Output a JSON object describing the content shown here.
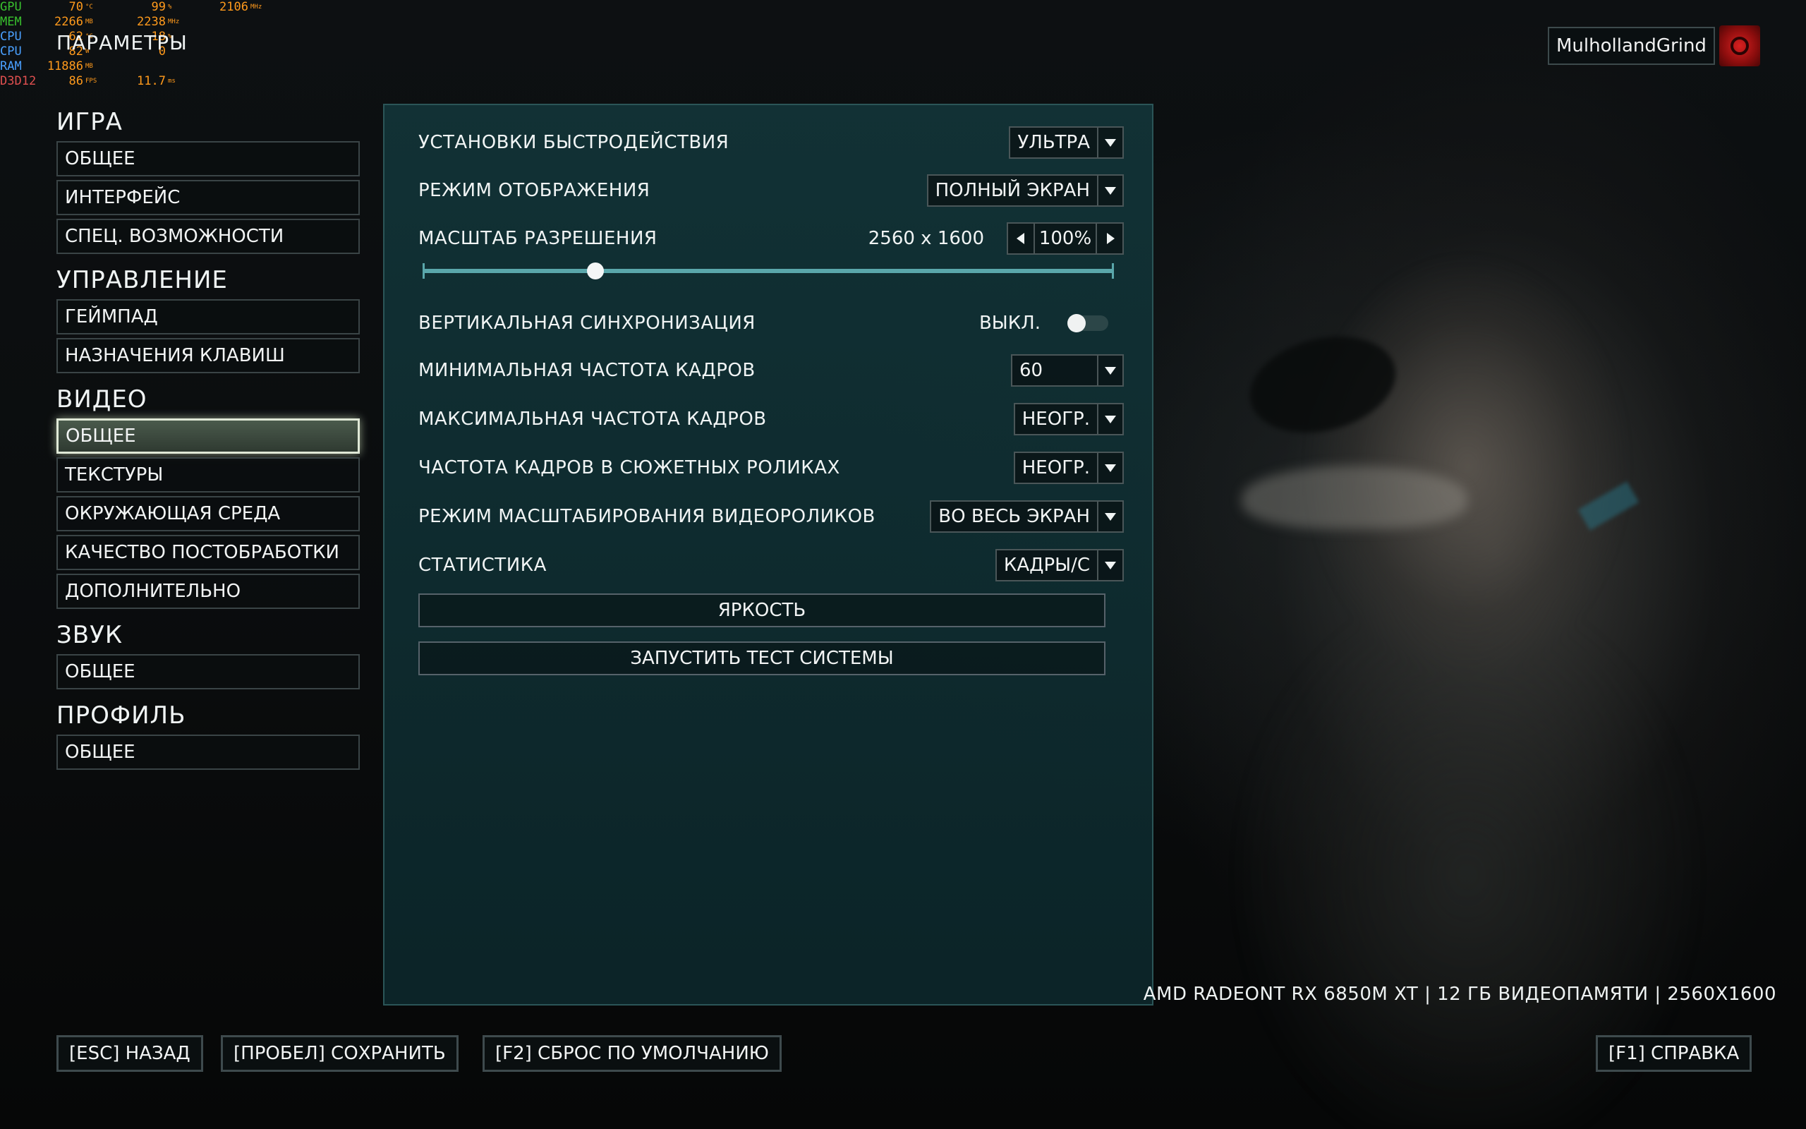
{
  "overlay": {
    "rows": [
      {
        "label": "GPU",
        "label_color": "green",
        "v1": "70",
        "u1": "°C",
        "v2": "99",
        "u2": "%",
        "v3": "2106",
        "u3": "MHz"
      },
      {
        "label": "MEM",
        "label_color": "green",
        "v1": "2266",
        "u1": "MB",
        "v2": "2238",
        "u2": "MHz",
        "v3": "",
        "u3": ""
      },
      {
        "label": "CPU",
        "label_color": "blue",
        "v1": "62",
        "u1": "°C",
        "v2": "18",
        "u2": "%",
        "v3": "",
        "u3": ""
      },
      {
        "label": "CPU",
        "label_color": "blue",
        "v1": "82",
        "u1": "W",
        "v2": "0",
        "u2": "",
        "v3": "",
        "u3": ""
      },
      {
        "label": "RAM",
        "label_color": "blue",
        "v1": "11886",
        "u1": "MB",
        "v2": "",
        "u2": "",
        "v3": "",
        "u3": ""
      },
      {
        "label": "D3D12",
        "label_color": "red",
        "v1": "86",
        "u1": "FPS",
        "v2": "11.7",
        "u2": "ms",
        "v3": "",
        "u3": ""
      }
    ]
  },
  "header": {
    "title": "ПАРАМЕТРЫ",
    "username": "MulhollandGrind"
  },
  "sidebar": {
    "sections": [
      {
        "title": "ИГРА",
        "items": [
          {
            "label": "ОБЩЕЕ",
            "selected": false
          },
          {
            "label": "ИНТЕРФЕЙС",
            "selected": false
          },
          {
            "label": "СПЕЦ. ВОЗМОЖНОСТИ",
            "selected": false
          }
        ]
      },
      {
        "title": "УПРАВЛЕНИЕ",
        "items": [
          {
            "label": "ГЕЙМПАД",
            "selected": false
          },
          {
            "label": "НАЗНАЧЕНИЯ КЛАВИШ",
            "selected": false
          }
        ]
      },
      {
        "title": "ВИДЕО",
        "items": [
          {
            "label": "ОБЩЕЕ",
            "selected": true
          },
          {
            "label": "ТЕКСТУРЫ",
            "selected": false
          },
          {
            "label": "ОКРУЖАЮЩАЯ СРЕДА",
            "selected": false
          },
          {
            "label": "КАЧЕСТВО ПОСТОБРАБОТКИ",
            "selected": false
          },
          {
            "label": "ДОПОЛНИТЕЛЬНО",
            "selected": false
          }
        ]
      },
      {
        "title": "ЗВУК",
        "items": [
          {
            "label": "ОБЩЕЕ",
            "selected": false
          }
        ]
      },
      {
        "title": "ПРОФИЛЬ",
        "items": [
          {
            "label": "ОБЩЕЕ",
            "selected": false
          }
        ]
      }
    ]
  },
  "settings": {
    "performance_preset": {
      "label": "УСТАНОВКИ БЫСТРОДЕЙСТВИЯ",
      "value": "УЛЬТРА"
    },
    "display_mode": {
      "label": "РЕЖИМ ОТОБРАЖЕНИЯ",
      "value": "ПОЛНЫЙ ЭКРАН"
    },
    "resolution_scale": {
      "label": "МАСШТАБ РАЗРЕШЕНИЯ",
      "resolution": "2560 x 1600",
      "value": "100%",
      "slider_fraction": 0.25
    },
    "vsync": {
      "label": "ВЕРТИКАЛЬНАЯ СИНХРОНИЗАЦИЯ",
      "value": "ВЫКЛ.",
      "on": false
    },
    "min_fps": {
      "label": "МИНИМАЛЬНАЯ ЧАСТОТА КАДРОВ",
      "value": "60"
    },
    "max_fps": {
      "label": "МАКСИМАЛЬНАЯ ЧАСТОТА КАДРОВ",
      "value": "НЕОГР."
    },
    "cutscene_fps": {
      "label": "ЧАСТОТА КАДРОВ В СЮЖЕТНЫХ РОЛИКАХ",
      "value": "НЕОГР."
    },
    "cutscene_scaling": {
      "label": "РЕЖИМ МАСШТАБИРОВАНИЯ ВИДЕОРОЛИКОВ",
      "value": "ВО ВЕСЬ ЭКРАН"
    },
    "statistics": {
      "label": "СТАТИСТИКА",
      "value": "КАДРЫ/С"
    },
    "brightness_button": "ЯРКОСТЬ",
    "benchmark_button": "ЗАПУСТИТЬ ТЕСТ СИСТЕМЫ"
  },
  "gpu_info": "AMD RADEONT RX 6850M XT | 12 ГБ ВИДЕОПАМЯТИ | 2560X1600",
  "footer": {
    "back": "[ESC] НАЗАД",
    "save": "[ПРОБЕЛ] СОХРАНИТЬ",
    "reset": "[F2] СБРОС ПО УМОЛЧАНИЮ",
    "help": "[F1] СПРАВКА"
  },
  "colors": {
    "panel_border": "#2b5557",
    "slider": "#5aa7ab",
    "osd_value": "#ff9a1c",
    "osd_green": "#39c12e",
    "osd_blue": "#4aa0ff",
    "osd_red": "#e05050"
  },
  "icons": {
    "avatar": "gears-cog-emblem-icon",
    "dropdown": "chevron-down-icon",
    "stepper_left": "arrow-left-icon",
    "stepper_right": "arrow-right-icon"
  }
}
